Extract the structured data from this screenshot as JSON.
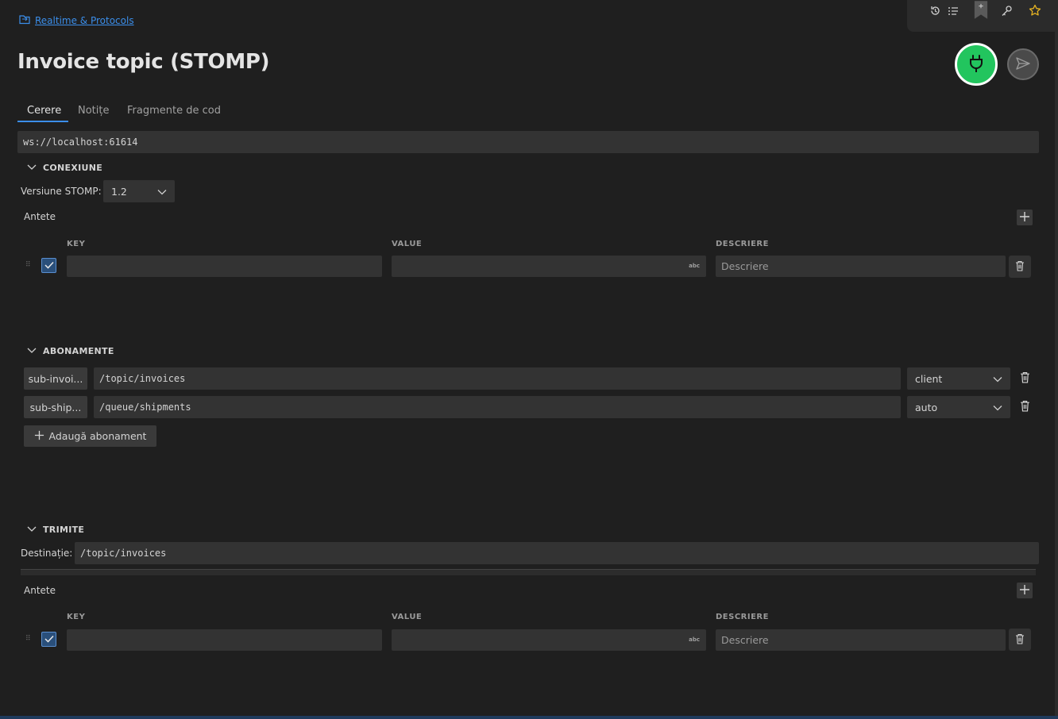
{
  "breadcrumb": {
    "label": "Realtime & Protocols"
  },
  "page": {
    "title": "Invoice topic (STOMP)"
  },
  "tabs": [
    {
      "label": "Cerere",
      "active": true
    },
    {
      "label": "Notițe",
      "active": false
    },
    {
      "label": "Fragmente de cod",
      "active": false
    }
  ],
  "url": {
    "value": "ws://localhost:61614"
  },
  "connection": {
    "heading": "CONEXIUNE",
    "version_label": "Versiune STOMP:",
    "version_value": "1.2",
    "headers_label": "Antete",
    "columns": {
      "key": "KEY",
      "value": "VALUE",
      "description": "DESCRIERE"
    },
    "row": {
      "key": "",
      "value": "",
      "value_badge": "abc",
      "description_placeholder": "Descriere",
      "checked": true
    }
  },
  "subscriptions": {
    "heading": "ABONAMENTE",
    "items": [
      {
        "name": "sub-invoi...",
        "destination": "/topic/invoices",
        "ack": "client"
      },
      {
        "name": "sub-ship...",
        "destination": "/queue/shipments",
        "ack": "auto"
      }
    ],
    "add_label": "Adaugă abonament"
  },
  "send": {
    "heading": "TRIMITE",
    "destination_label": "Destinație:",
    "destination_value": "/topic/invoices",
    "headers_label": "Antete",
    "columns": {
      "key": "KEY",
      "value": "VALUE",
      "description": "DESCRIERE"
    },
    "row": {
      "key": "",
      "value": "",
      "value_badge": "abc",
      "description_placeholder": "Descriere",
      "checked": true
    }
  },
  "colors": {
    "accent": "#3b8eea",
    "connect": "#22c55e",
    "background": "#1f1f1f",
    "field": "#333333"
  },
  "icons": [
    "history-icon",
    "list-icon",
    "bookmark-icon",
    "key-icon",
    "star-icon",
    "plug-icon",
    "send-icon",
    "chevron-down-icon",
    "plus-icon",
    "trash-icon",
    "check-icon",
    "grip-icon"
  ]
}
